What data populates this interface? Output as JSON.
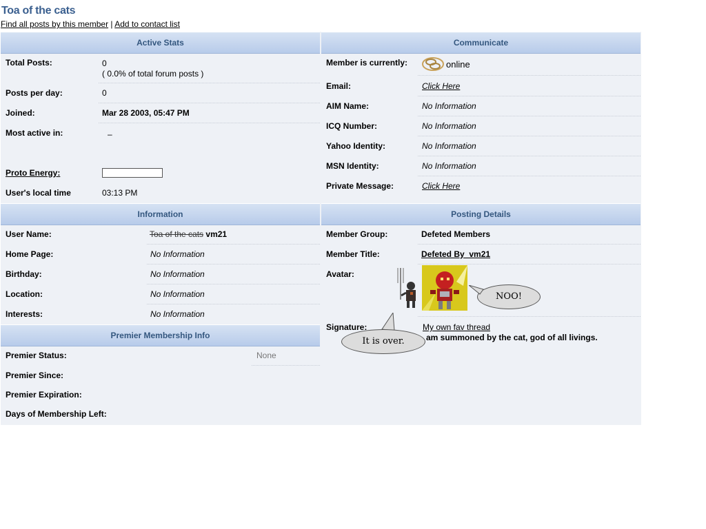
{
  "page": {
    "title": "Toa of the cats",
    "links": {
      "find_posts": "Find all posts by this member",
      "separator": " | ",
      "add_contact": "Add to contact list"
    }
  },
  "active_stats": {
    "header": "Active Stats",
    "total_posts_label": "Total Posts:",
    "total_posts_value": "0",
    "total_posts_percent": "( 0.0% of total forum posts )",
    "posts_per_day_label": "Posts per day:",
    "posts_per_day_value": "0",
    "joined_label": "Joined:",
    "joined_value": "Mar 28 2003, 05:47 PM",
    "most_active_label": "Most active in:",
    "most_active_value": "–",
    "proto_energy_label": "Proto Energy:",
    "proto_energy_level": 0,
    "local_time_label": "User's local time",
    "local_time_value": "03:13 PM"
  },
  "communicate": {
    "header": "Communicate",
    "status_label": "Member is currently:",
    "status_value": "online",
    "status_icon": "online-status-icon",
    "email_label": "Email:",
    "email_value": "Click Here",
    "aim_label": "AIM Name:",
    "aim_value": "No Information",
    "icq_label": "ICQ Number:",
    "icq_value": "No Information",
    "yahoo_label": "Yahoo Identity:",
    "yahoo_value": "No Information",
    "msn_label": "MSN Identity:",
    "msn_value": "No Information",
    "pm_label": "Private Message:",
    "pm_value": "Click Here"
  },
  "information": {
    "header": "Information",
    "username_label": "User Name:",
    "username_struck": "Toa of the cats",
    "username_new": "vm21",
    "homepage_label": "Home Page:",
    "homepage_value": "No Information",
    "birthday_label": "Birthday:",
    "birthday_value": "No Information",
    "location_label": "Location:",
    "location_value": "No Information",
    "interests_label": "Interests:",
    "interests_value": "No Information"
  },
  "premier": {
    "header": "Premier Membership Info",
    "status_label": "Premier Status:",
    "status_value": "None",
    "since_label": "Premier Since:",
    "expiration_label": "Premier Expiration:",
    "days_left_label": "Days of Membership Left:"
  },
  "posting": {
    "header": "Posting Details",
    "group_label": "Member Group:",
    "group_value": "Defeted Members",
    "title_label": "Member Title:",
    "title_value": "Defeted By  vm21",
    "avatar_label": "Avatar:",
    "avatar_bubble": "NOO!",
    "signature_label": "Signature:",
    "signature_link": "My own fav thread",
    "signature_text": "am summoned by the cat, god of all livings.",
    "signature_bubble": "It is over."
  }
}
